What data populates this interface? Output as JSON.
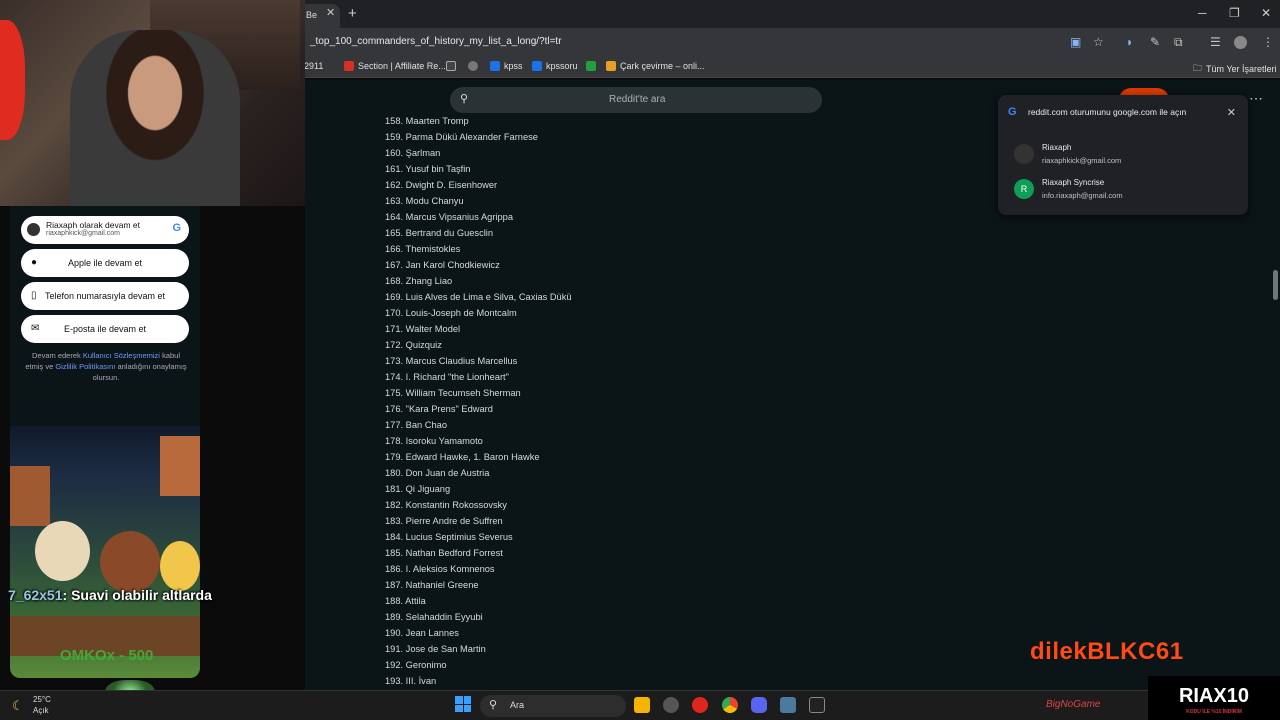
{
  "browser": {
    "tab_label": "Be",
    "tab_close": "✕",
    "new_tab": "+",
    "url": "_top_100_commanders_of_history_my_list_a_long/?tl=tr",
    "bookmarks": [
      {
        "label": "2911",
        "color": "#666"
      },
      {
        "label": "Section | Affiliate Re...",
        "color": "#d93025"
      },
      {
        "label": "",
        "color": "#444"
      },
      {
        "label": "",
        "color": "#777"
      },
      {
        "label": "kpss",
        "color": "#1a73e8"
      },
      {
        "label": "kpssoru",
        "color": "#1a73e8"
      },
      {
        "label": "",
        "color": "#20a040"
      },
      {
        "label": "Çark çevirme – onli...",
        "color": "#e8a020"
      }
    ],
    "all_bookmarks": "Tüm Yer İşaretleri"
  },
  "reddit": {
    "search_placeholder": "Reddit'te ara",
    "list": [
      "158. Maarten Tromp",
      "159. Parma Dükü Alexander Farnese",
      "160. Şarlman",
      "161. Yusuf bin Taşfin",
      "162. Dwight D. Eisenhower",
      "163. Modu Chanyu",
      "164. Marcus Vipsanius Agrippa",
      "165. Bertrand du Guesclin",
      "166. Themistokles",
      "167. Jan Karol Chodkiewicz",
      "168. Zhang Liao",
      "169. Luis Alves de Lima e Silva, Caxias Dükü",
      "170. Louis-Joseph de Montcalm",
      "171. Walter Model",
      "172. Quizquiz",
      "173. Marcus Claudius Marcellus",
      "174. I. Richard \"the Lionheart\"",
      "175. William Tecumseh Sherman",
      "176. \"Kara Prens\" Edward",
      "177. Ban Chao",
      "178. Isoroku Yamamoto",
      "179. Edward Hawke, 1. Baron Hawke",
      "180. Don Juan de Austria",
      "181. Qi Jiguang",
      "182. Konstantin Rokossovsky",
      "183. Pierre Andre de Suffren",
      "184. Lucius Septimius Severus",
      "185. Nathan Bedford Forrest",
      "186. I. Aleksios Komnenos",
      "187. Nathaniel Greene",
      "188. Attila",
      "189. Selahaddin Eyyubi",
      "190. Jean Lannes",
      "191. Jose de San Martin",
      "192. Geronimo",
      "193. III. İvan"
    ]
  },
  "google_popup": {
    "title": "reddit.com oturumunu google.com ile açın",
    "accounts": [
      {
        "name": "Riaxaph",
        "email": "riaxaphkick@gmail.com",
        "initial": "",
        "color": "#333"
      },
      {
        "name": "Riaxaph Syncrise",
        "email": "info.riaxaph@gmail.com",
        "initial": "R",
        "color": "#0f9d58"
      }
    ]
  },
  "auth_panel": {
    "continue_as": "Riaxaph olarak devam et",
    "continue_email": "riaxaphkick@gmail.com",
    "apple": "Apple ile devam et",
    "phone": "Telefon numarasıyla devam et",
    "email": "E-posta ile devam et",
    "legal_prefix": "Devam ederek",
    "terms": "Kullanıcı Sözleşmemizi",
    "legal_mid": "kabul etmiş ve",
    "privacy": "Gizlilik Politikasını",
    "legal_suffix": "anladığını onaylamış olursun."
  },
  "stream": {
    "chat_user": "7_62x51",
    "chat_text": ": Suavi olabilir altlarda",
    "promo": "OMKOx - 500",
    "overlay_name": "dilekBLKC61",
    "brand": "RIAX10",
    "brand_sub": "KODU İLE %10 İNDİRİM",
    "sponsor": "BigNoGame"
  },
  "taskbar": {
    "temp": "25°C",
    "weather": "Açık",
    "search": "Ara"
  }
}
